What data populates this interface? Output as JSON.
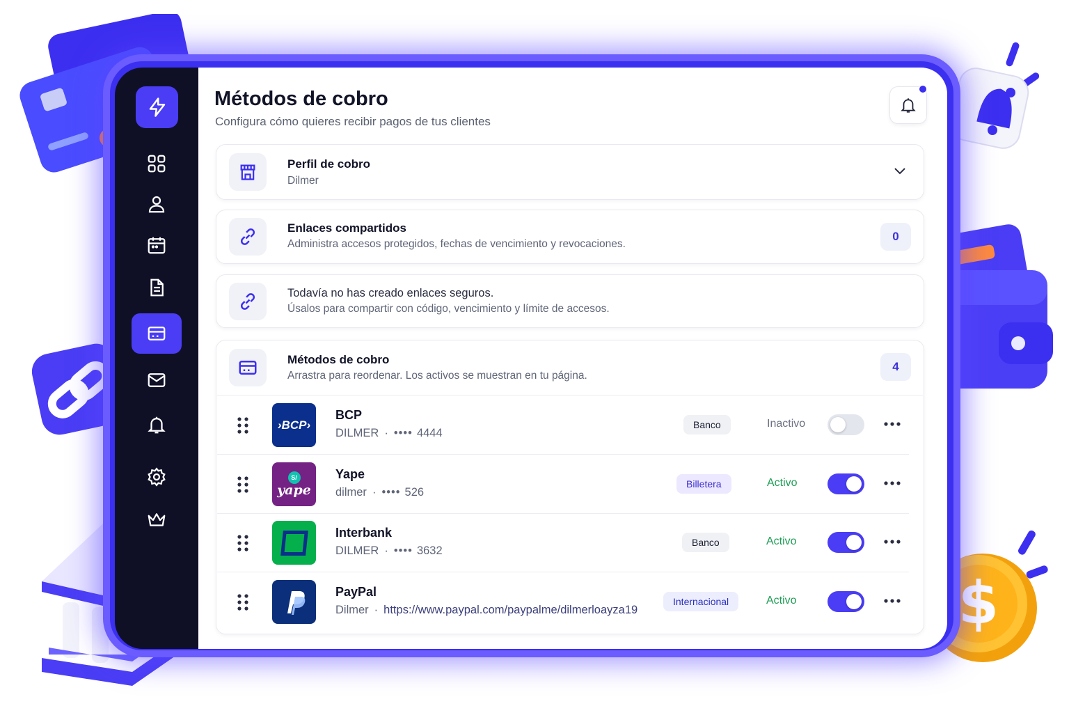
{
  "header": {
    "title": "Métodos de cobro",
    "subtitle": "Configura cómo quieres recibir pagos de tus clientes"
  },
  "sidebar": {
    "items": [
      {
        "icon": "grid-icon",
        "active": false
      },
      {
        "icon": "user-icon",
        "active": false
      },
      {
        "icon": "calendar-icon",
        "active": false
      },
      {
        "icon": "document-icon",
        "active": false
      },
      {
        "icon": "payment-card-icon",
        "active": true
      },
      {
        "icon": "mail-icon",
        "active": false
      },
      {
        "icon": "bell-icon",
        "active": false
      },
      {
        "icon": "gear-icon",
        "active": false
      },
      {
        "icon": "crown-icon",
        "active": false
      }
    ]
  },
  "profile": {
    "title": "Perfil de cobro",
    "value": "Dilmer"
  },
  "shared_links": {
    "title": "Enlaces compartidos",
    "description": "Administra accesos protegidos, fechas de vencimiento y revocaciones.",
    "count": "0"
  },
  "empty_links": {
    "line1": "Todavía no has creado enlaces seguros.",
    "line2": "Úsalos para compartir con código, vencimiento y límite de accesos."
  },
  "methods": {
    "title": "Métodos de cobro",
    "description": "Arrastra para reordenar. Los activos se muestran en tu página.",
    "count": "4",
    "items": [
      {
        "name": "BCP",
        "holder": "DILMER",
        "mask": "••••",
        "number": "4444",
        "tag": "Banco",
        "status": "Inactivo",
        "enabled": false,
        "logo_text": "›BCP›",
        "logo_color": "#0a2f8c"
      },
      {
        "name": "Yape",
        "holder": "dilmer",
        "mask": "••••",
        "number": "526",
        "tag": "Billetera",
        "status": "Activo",
        "enabled": true,
        "logo_text": "yape",
        "logo_badge": "S/",
        "logo_color": "#742284"
      },
      {
        "name": "Interbank",
        "holder": "DILMER",
        "mask": "••••",
        "number": "3632",
        "tag": "Banco",
        "status": "Activo",
        "enabled": true,
        "logo_color": "#05b04c"
      },
      {
        "name": "PayPal",
        "holder": "Dilmer",
        "link": "https://www.paypal.com/paypalme/dilmerloayza19",
        "tag": "Internacional",
        "status": "Activo",
        "enabled": true,
        "logo_color": "#0b2f7a"
      }
    ]
  },
  "colors": {
    "accent": "#4a3df5",
    "sidebar": "#0f1026",
    "active_status": "#1f9d55"
  }
}
